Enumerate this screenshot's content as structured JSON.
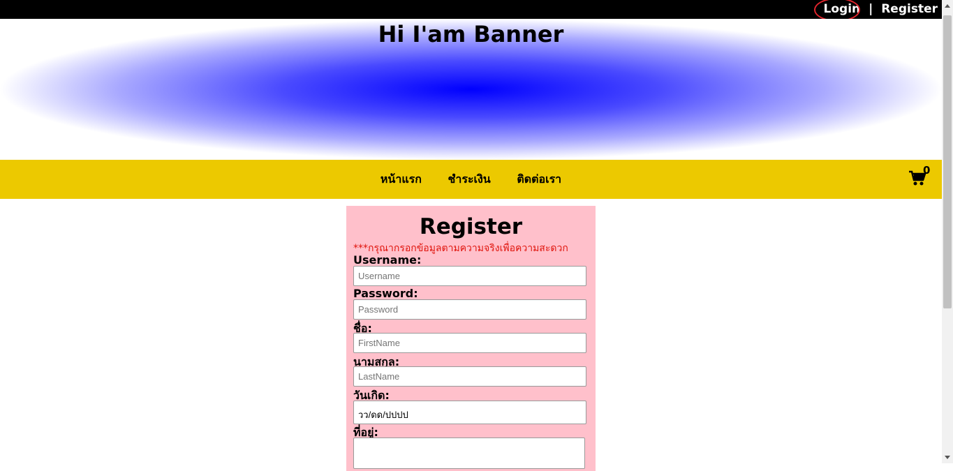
{
  "topbar": {
    "login_label": "Login",
    "separator": "|",
    "register_label": "Register"
  },
  "banner": {
    "title": "Hi I'am Banner"
  },
  "nav": {
    "items": [
      "หน้าแรก",
      "ชำระเงิน",
      "ติดต่อเรา"
    ],
    "cart_count": "0"
  },
  "form": {
    "title": "Register",
    "notice": "***กรุณากรอกข้อมูลตามความจริงเพื่อความสะดวก",
    "fields": [
      {
        "label": "Username:",
        "placeholder": "Username"
      },
      {
        "label": "Password:",
        "placeholder": "Password"
      },
      {
        "label": "ชื่อ:",
        "placeholder": "FirstName"
      },
      {
        "label": "นามสกุล:",
        "placeholder": "LastName"
      },
      {
        "label": "วันเกิด:",
        "value": "วว/ดด/ปปปป"
      },
      {
        "label": "ที่อยู่:"
      }
    ]
  }
}
